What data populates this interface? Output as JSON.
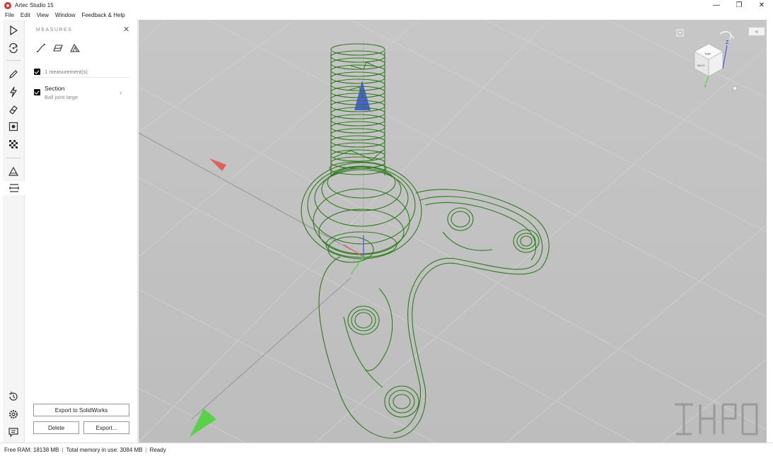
{
  "window": {
    "title": "Artec Studio 15",
    "controls": {
      "minimize": "—",
      "maximize": "❐",
      "close": "✕"
    }
  },
  "menu": [
    "File",
    "Edit",
    "View",
    "Window",
    "Feedback & Help"
  ],
  "toolbar": {
    "top_tools": [
      "play-icon",
      "autopilot-icon",
      "edit-icon",
      "tools-icon",
      "texture-icon",
      "register-icon",
      "checker-icon"
    ],
    "lower_tools": [
      "triangle-icon",
      "measures-icon"
    ],
    "bottom_tools": [
      "history-icon",
      "settings-icon",
      "chat-icon"
    ]
  },
  "panel": {
    "header": "MEASURES",
    "close": "✕",
    "measure_tools": [
      "distance-icon",
      "section-icon",
      "surface-distance-icon"
    ],
    "measurement_count": "1 measurement(s)",
    "measurements": [
      {
        "title": "Section",
        "subtitle": "Ball joint large",
        "arrow": "›"
      }
    ],
    "buttons": {
      "export_solidworks": "Export to SolidWorks",
      "delete": "Delete",
      "export": "Export..."
    }
  },
  "viewport": {
    "collapse": "«",
    "viewcube": {
      "top": "TOP",
      "back": "BACK",
      "axis_z": "Z",
      "axis_y": "Y"
    },
    "colors": {
      "background": "#c4c4c4",
      "wireframe": "#2f7a1e",
      "x_axis": "#e06060",
      "y_axis": "#5bd04a",
      "z_axis": "#4a5fd8"
    }
  },
  "status": {
    "free_ram": "Free RAM: 18138 MB",
    "total_memory": "Total memory in use: 3084 MB",
    "state": "Ready"
  }
}
